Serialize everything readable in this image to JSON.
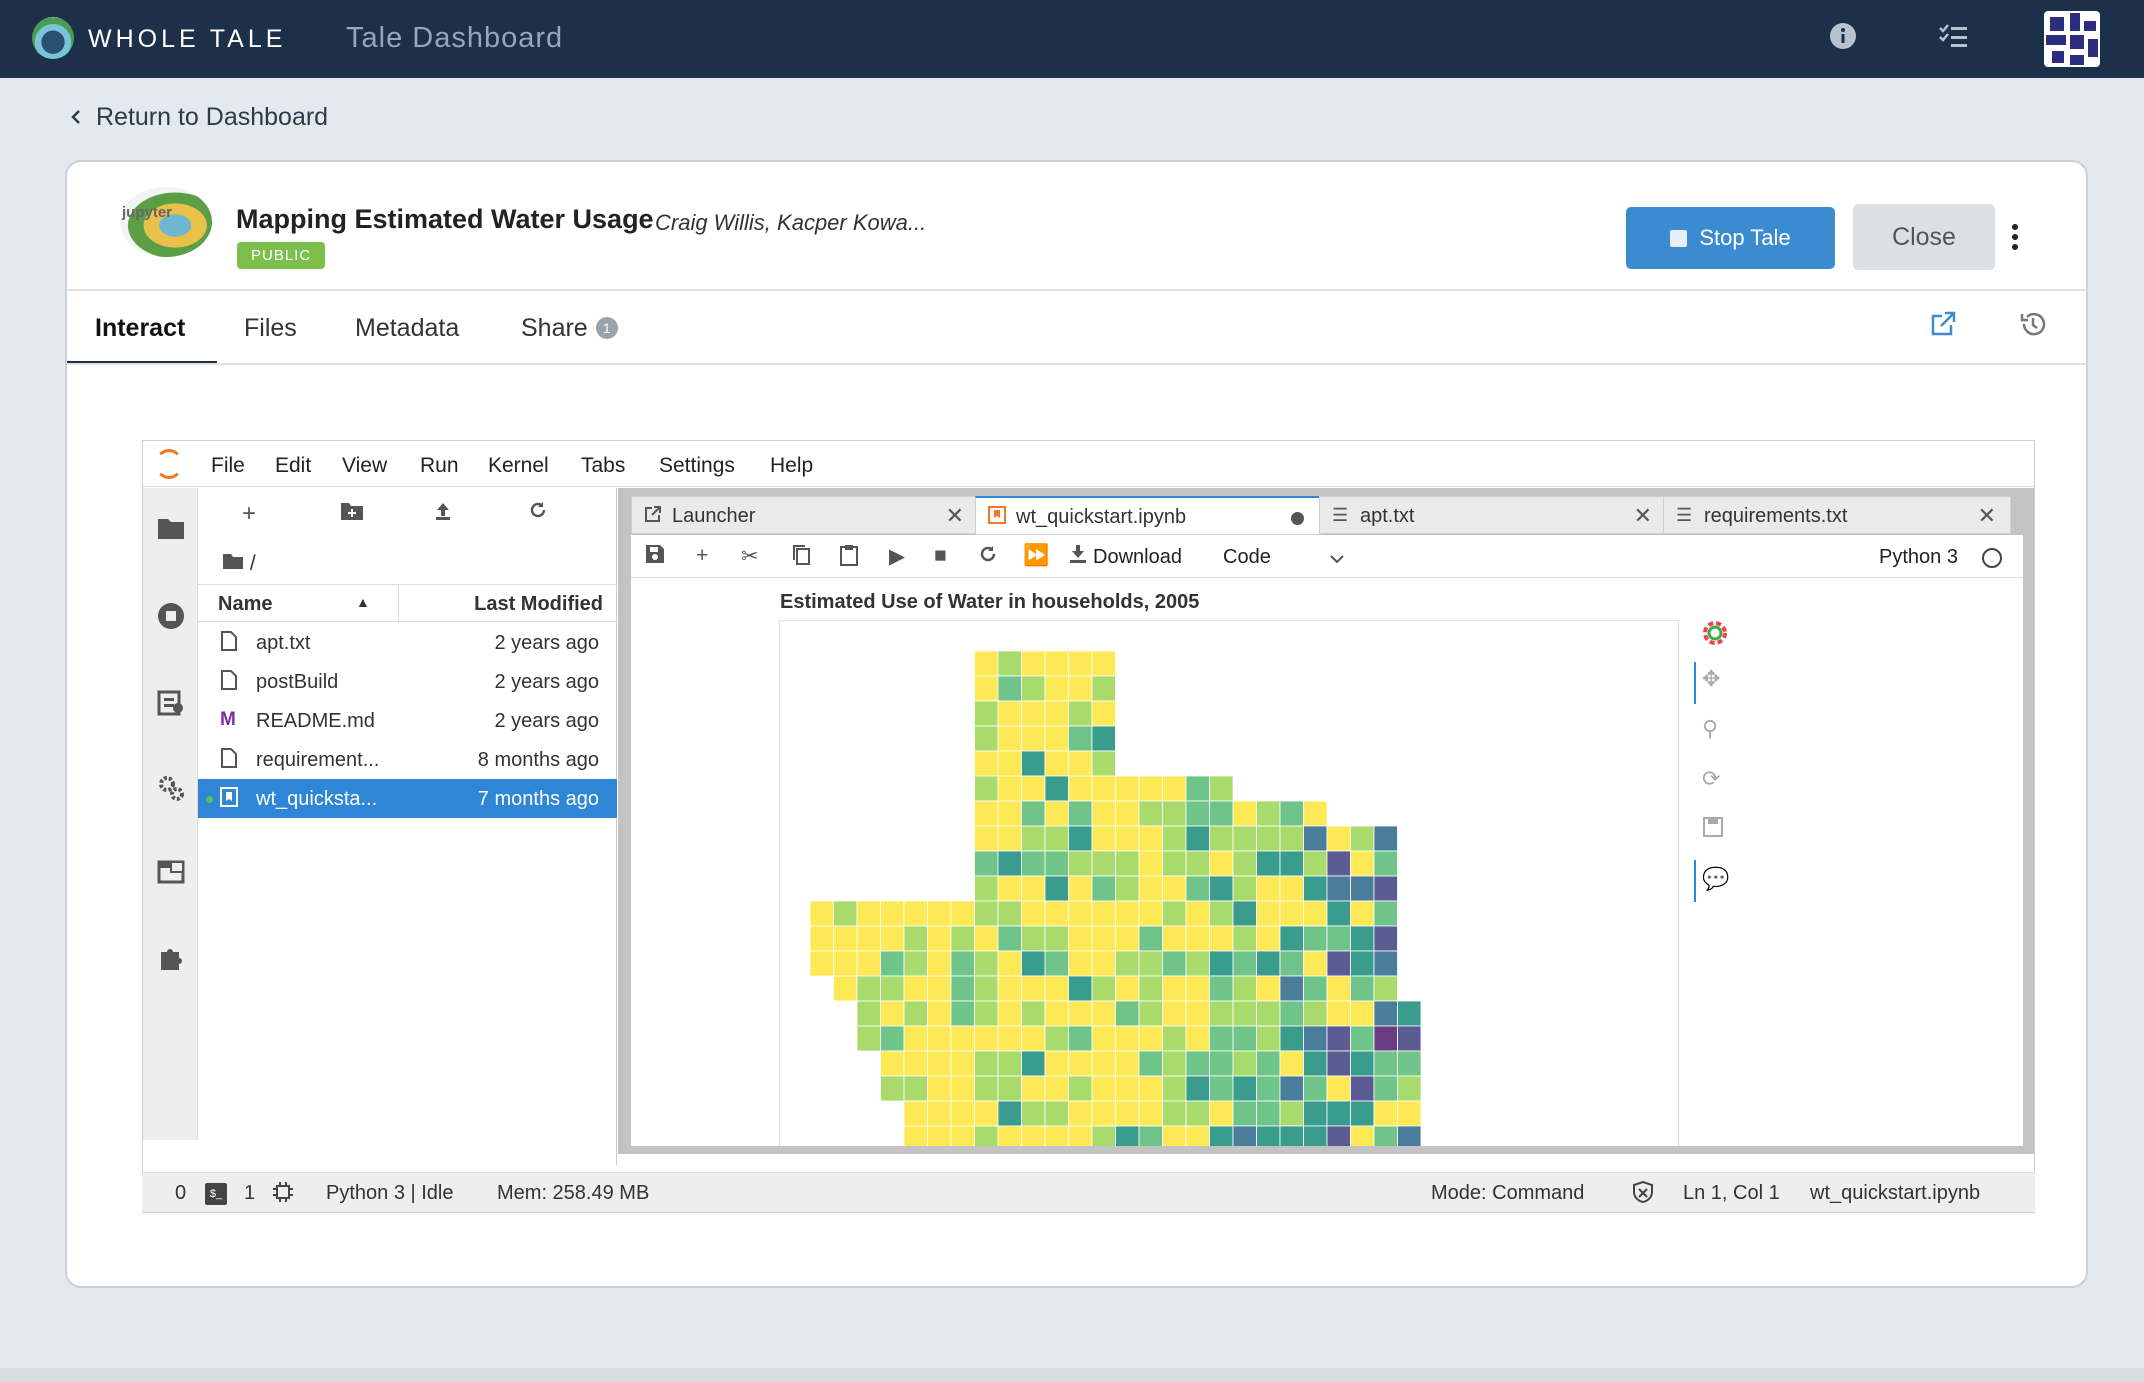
{
  "topbar": {
    "brand_main": "WHOLE",
    "brand_sub": "TALE",
    "page_title": "Tale Dashboard",
    "icons": [
      "info-icon",
      "tasks-icon"
    ]
  },
  "nav": {
    "back_label": "Return to Dashboard"
  },
  "tale": {
    "logo_text": "jupyter",
    "title": "Mapping Estimated Water Usage",
    "authors": "Craig Willis, Kacper Kowa...",
    "visibility": "PUBLIC",
    "stop_label": "Stop Tale",
    "close_label": "Close"
  },
  "tabs": {
    "interact": "Interact",
    "files": "Files",
    "metadata": "Metadata",
    "share": "Share",
    "share_count": "1"
  },
  "jupyterlab": {
    "menu": [
      "File",
      "Edit",
      "View",
      "Run",
      "Kernel",
      "Tabs",
      "Settings",
      "Help"
    ],
    "filebrowser": {
      "path": "/",
      "col_name": "Name",
      "col_modified": "Last Modified",
      "files": [
        {
          "name": "apt.txt",
          "modified": "2 years ago",
          "icon": "file-icon"
        },
        {
          "name": "postBuild",
          "modified": "2 years ago",
          "icon": "file-icon"
        },
        {
          "name": "README.md",
          "modified": "2 years ago",
          "icon": "markdown-icon"
        },
        {
          "name": "requirement...",
          "modified": "8 months ago",
          "icon": "file-icon"
        },
        {
          "name": "wt_quicksta...",
          "modified": "7 months ago",
          "icon": "notebook-icon"
        }
      ]
    },
    "doc_tabs": [
      {
        "label": "Launcher"
      },
      {
        "label": "wt_quickstart.ipynb"
      },
      {
        "label": "apt.txt"
      },
      {
        "label": "requirements.txt"
      }
    ],
    "toolbar": {
      "download_label": "Download",
      "cell_type": "Code",
      "kernel_name": "Python 3"
    },
    "chart_title": "Estimated Use of Water in households, 2005",
    "map_palette": [
      "#fde855",
      "#a9db6c",
      "#6fc48a",
      "#3a9c8c",
      "#4a7d9a",
      "#5b5c94",
      "#6a3d83"
    ],
    "status": {
      "terminals": "0",
      "kernels": "1",
      "kernel_status": "Python 3 | Idle",
      "memory": "Mem: 258.49 MB",
      "mode": "Mode: Command",
      "cursor": "Ln 1, Col 1",
      "file": "wt_quickstart.ipynb"
    }
  }
}
